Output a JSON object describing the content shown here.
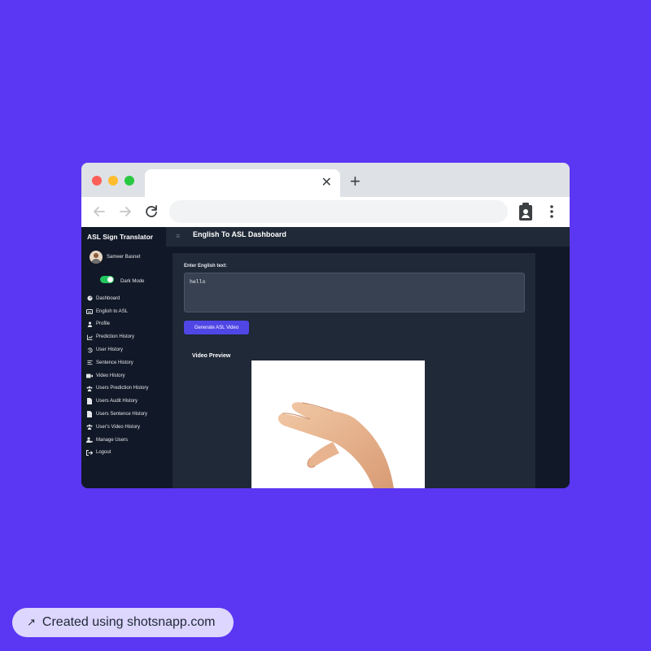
{
  "browser": {
    "tab_close": "✕",
    "new_tab": "+"
  },
  "app": {
    "brand": "ASL Sign Translator",
    "user_name": "Sameer Basnet",
    "dark_mode_label": "Dark Mode",
    "dark_mode_on": true,
    "menu": [
      {
        "label": "Dashboard",
        "icon": "dashboard-icon"
      },
      {
        "label": "English to ASL",
        "icon": "keyboard-icon"
      },
      {
        "label": "Profile",
        "icon": "user-icon"
      },
      {
        "label": "Prediction History",
        "icon": "chart-line-icon"
      },
      {
        "label": "User History",
        "icon": "history-icon"
      },
      {
        "label": "Sentence History",
        "icon": "list-icon"
      },
      {
        "label": "Video History",
        "icon": "video-icon"
      },
      {
        "label": "Users Prediction History",
        "icon": "users-icon"
      },
      {
        "label": "Users Audit History",
        "icon": "file-icon"
      },
      {
        "label": "Users Sentence History",
        "icon": "file-icon"
      },
      {
        "label": "User's Video History",
        "icon": "users-icon"
      },
      {
        "label": "Manage Users",
        "icon": "user-cog-icon"
      },
      {
        "label": "Logout",
        "icon": "logout-icon"
      }
    ],
    "page_title": "English To ASL Dashboard",
    "hamburger": "≡",
    "input_label": "Enter English text:",
    "input_value": "hello",
    "generate_button": "Generate ASL Video",
    "video_label": "Video Preview"
  },
  "watermark": {
    "icon": "↗",
    "text": "Created using shotsnapp.com"
  },
  "colors": {
    "background": "#5b36f3",
    "sidebar": "#111827",
    "card": "#1f2937",
    "accent": "#4f46e5",
    "toggle": "#22c55e"
  }
}
